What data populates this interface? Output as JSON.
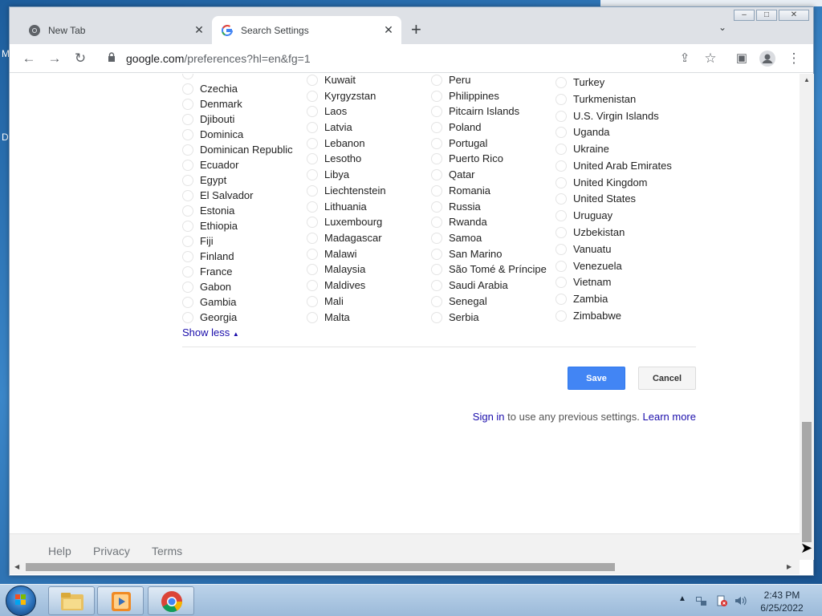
{
  "desktop": {
    "edge_text_1": "M",
    "edge_text_2": "D"
  },
  "browser": {
    "tabs": [
      {
        "label": "New Tab",
        "icon": "chrome-icon",
        "active": false
      },
      {
        "label": "Search Settings",
        "icon": "google-g-icon",
        "active": true
      }
    ],
    "new_tab_label": "+",
    "url_host": "google.com",
    "url_path": "/preferences?hl=en&fg=1"
  },
  "regions": {
    "columns": [
      [
        "",
        "Czechia",
        "Denmark",
        "Djibouti",
        "Dominica",
        "Dominican Republic",
        "Ecuador",
        "Egypt",
        "El Salvador",
        "Estonia",
        "Ethiopia",
        "Fiji",
        "Finland",
        "France",
        "Gabon",
        "Gambia",
        "Georgia"
      ],
      [
        "Kuwait",
        "Kyrgyzstan",
        "Laos",
        "Latvia",
        "Lebanon",
        "Lesotho",
        "Libya",
        "Liechtenstein",
        "Lithuania",
        "Luxembourg",
        "Madagascar",
        "Malawi",
        "Malaysia",
        "Maldives",
        "Mali",
        "Malta"
      ],
      [
        "Peru",
        "Philippines",
        "Pitcairn Islands",
        "Poland",
        "Portugal",
        "Puerto Rico",
        "Qatar",
        "Romania",
        "Russia",
        "Rwanda",
        "Samoa",
        "San Marino",
        "São Tomé & Príncipe",
        "Saudi Arabia",
        "Senegal",
        "Serbia"
      ],
      [
        "Turkey",
        "Turkmenistan",
        "U.S. Virgin Islands",
        "Uganda",
        "Ukraine",
        "United Arab Emirates",
        "United Kingdom",
        "United States",
        "Uruguay",
        "Uzbekistan",
        "Vanuatu",
        "Venezuela",
        "Vietnam",
        "Zambia",
        "Zimbabwe"
      ]
    ],
    "show_less": "Show less",
    "show_less_glyph": "▲"
  },
  "actions": {
    "save": "Save",
    "cancel": "Cancel"
  },
  "signin": {
    "link": "Sign in",
    "text": " to use any previous settings. ",
    "learn_more": "Learn more"
  },
  "footer": {
    "help": "Help",
    "privacy": "Privacy",
    "terms": "Terms"
  },
  "taskbar": {
    "buttons": [
      "explorer-icon",
      "media-player-icon",
      "chrome-icon"
    ],
    "tray_icons": [
      "show-hidden-icons-icon",
      "network-icon",
      "action-center-icon",
      "volume-icon"
    ],
    "time": "2:43 PM",
    "date": "6/25/2022"
  }
}
